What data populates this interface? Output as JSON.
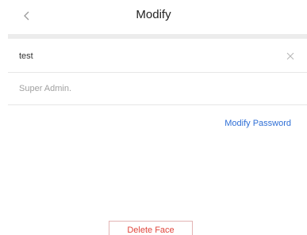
{
  "header": {
    "title": "Modify",
    "back_icon": "chevron-left-icon"
  },
  "form": {
    "name_value": "test",
    "clear_icon": "close-icon",
    "role_text": "Super Admin."
  },
  "actions": {
    "modify_password_label": "Modify Password",
    "delete_face_label": "Delete Face"
  },
  "colors": {
    "link": "#2f6fd6",
    "danger": "#e0463c",
    "muted_text": "#a0a0a0",
    "divider": "#ececec"
  }
}
